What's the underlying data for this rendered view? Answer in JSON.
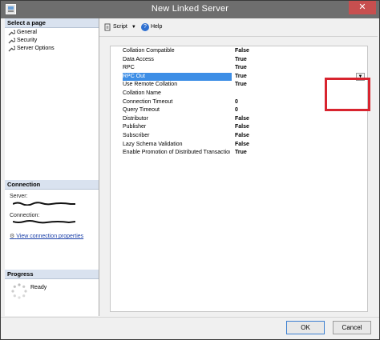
{
  "window": {
    "title": "New Linked Server",
    "close_glyph": "✕"
  },
  "sidebar": {
    "select_header": "Select a page",
    "pages": [
      "General",
      "Security",
      "Server Options"
    ],
    "connection_header": "Connection",
    "server_label": "Server:",
    "connection_label": "Connection:",
    "view_link": "View connection properties",
    "progress_header": "Progress",
    "progress_status": "Ready"
  },
  "toolbar": {
    "script_label": "Script",
    "help_label": "Help"
  },
  "options": [
    {
      "name": "Collation Compatible",
      "value": "False"
    },
    {
      "name": "Data Access",
      "value": "True"
    },
    {
      "name": "RPC",
      "value": "True"
    },
    {
      "name": "RPC Out",
      "value": "True"
    },
    {
      "name": "Use Remote Collation",
      "value": "True"
    },
    {
      "name": "Collation Name",
      "value": ""
    },
    {
      "name": "Connection Timeout",
      "value": "0"
    },
    {
      "name": "Query Timeout",
      "value": "0"
    },
    {
      "name": "Distributor",
      "value": "False"
    },
    {
      "name": "Publisher",
      "value": "False"
    },
    {
      "name": "Subscriber",
      "value": "False"
    },
    {
      "name": "Lazy Schema Validation",
      "value": "False"
    },
    {
      "name": "Enable Promotion of Distributed Transaction",
      "value": "True"
    }
  ],
  "footer": {
    "ok_label": "OK",
    "cancel_label": "Cancel"
  },
  "colors": {
    "highlight": "#d8242f",
    "selected_row": "#3d8ee6",
    "link": "#1a3fa8"
  }
}
